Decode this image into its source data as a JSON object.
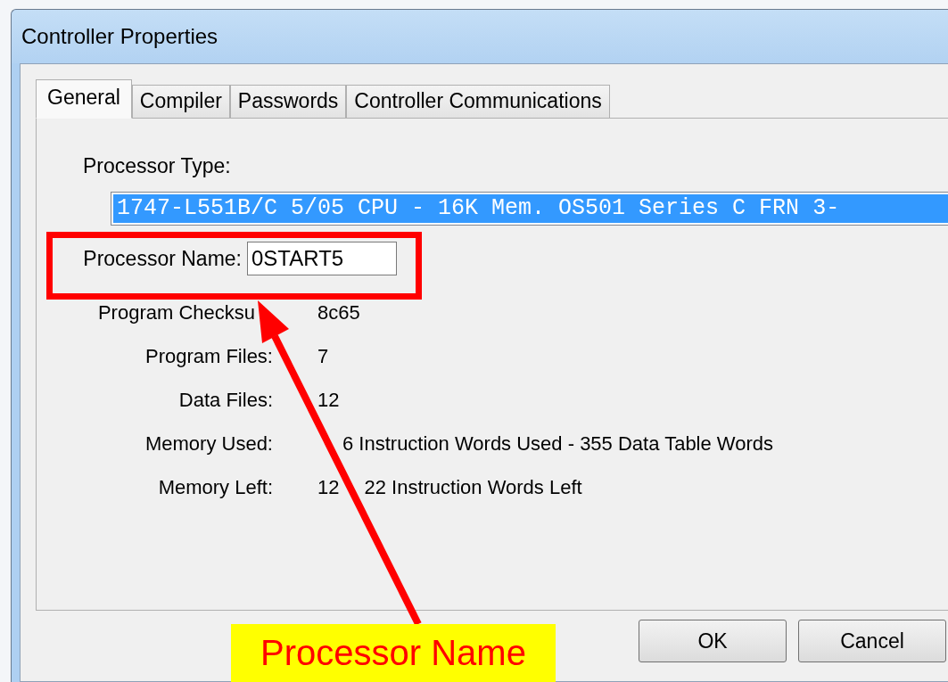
{
  "window": {
    "title": "Controller Properties"
  },
  "tabs": [
    {
      "label": "General",
      "selected": true
    },
    {
      "label": "Compiler",
      "selected": false
    },
    {
      "label": "Passwords",
      "selected": false
    },
    {
      "label": "Controller Communications",
      "selected": false
    }
  ],
  "processor_type": {
    "label": "Processor Type:",
    "value": "1747-L551B/C 5/05 CPU - 16K Mem. OS501 Series C FRN 3-"
  },
  "processor_name": {
    "label": "Processor Name:",
    "value": "0START5"
  },
  "info_rows": [
    {
      "label": "Program Checksu",
      "label_obscured": true,
      "value": [
        "8c65"
      ]
    },
    {
      "label": "Program Files:",
      "value": [
        "7"
      ]
    },
    {
      "label": "Data Files:",
      "value": [
        "12"
      ]
    },
    {
      "label": "Memory Used:",
      "value_obscured_start": true,
      "value": [
        "6 Instruction Words Used - 355 Data Table Words"
      ]
    },
    {
      "label": "Memory Left:",
      "value": [
        "12",
        "22 Instruction Words Left"
      ]
    }
  ],
  "buttons": [
    "OK",
    "Cancel"
  ],
  "annotation": {
    "callout": "Processor Name"
  }
}
